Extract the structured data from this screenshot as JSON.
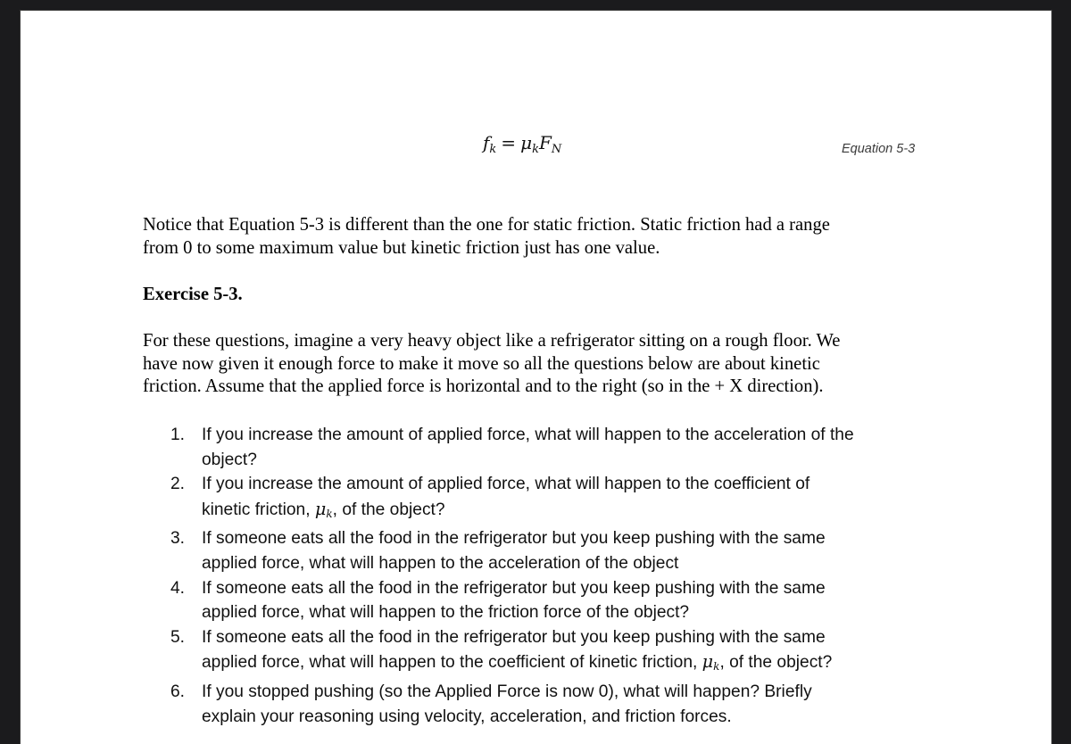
{
  "equation": {
    "lhs_symbol": "f",
    "lhs_subscript": "k",
    "operator": "=",
    "rhs_coefficient_symbol": "μ",
    "rhs_coefficient_subscript": "k",
    "rhs_force_symbol": "F",
    "rhs_force_subscript": "N",
    "label": "Equation 5-3"
  },
  "paragraph1": {
    "lines": [
      "Notice that Equation 5-3 is different than the one for static friction.  Static friction had a range",
      "from 0 to some maximum value but kinetic friction just has one value."
    ]
  },
  "exercise_heading": "Exercise 5-3.",
  "paragraph2": {
    "lines": [
      "For these questions, imagine a very heavy object like a refrigerator sitting on a rough floor.  We",
      "have now given it enough force to make it move so all the questions below are about kinetic",
      "friction.  Assume that the applied force is horizontal and to the right (so in the + X direction)."
    ]
  },
  "questions": [
    {
      "number": "1.",
      "lines": [
        "If you increase the amount of applied force, what will happen to the acceleration of the",
        "object?"
      ]
    },
    {
      "number": "2.",
      "line1": "If you increase the amount of applied force, what will happen to the coefficient of",
      "line2_before": "kinetic friction, ",
      "mu": "μ",
      "mu_sub": "k",
      "line2_after": ", of the object?"
    },
    {
      "number": "3.",
      "lines": [
        "If someone eats all the food in the refrigerator but you keep pushing with the same",
        "applied force, what will happen to the acceleration of the object"
      ]
    },
    {
      "number": "4.",
      "lines": [
        "If someone eats all the food in the refrigerator but you keep pushing with the same",
        "applied force, what will happen to the friction force of the object?"
      ]
    },
    {
      "number": "5.",
      "line1": "If someone eats all the food in the refrigerator but you keep pushing with the same",
      "line2_before": "applied force, what will happen to the coefficient of kinetic friction, ",
      "mu": "μ",
      "mu_sub": "k",
      "line2_after": ", of the object?"
    },
    {
      "number": "6.",
      "lines": [
        "If you stopped pushing (so the Applied Force is now 0), what will happen?  Briefly",
        "explain your reasoning using velocity, acceleration, and friction forces."
      ]
    }
  ],
  "colors": {
    "frame": "#1b1b1d",
    "page": "#ffffff",
    "text": "#000000",
    "equation_label": "#3c3c3c"
  }
}
